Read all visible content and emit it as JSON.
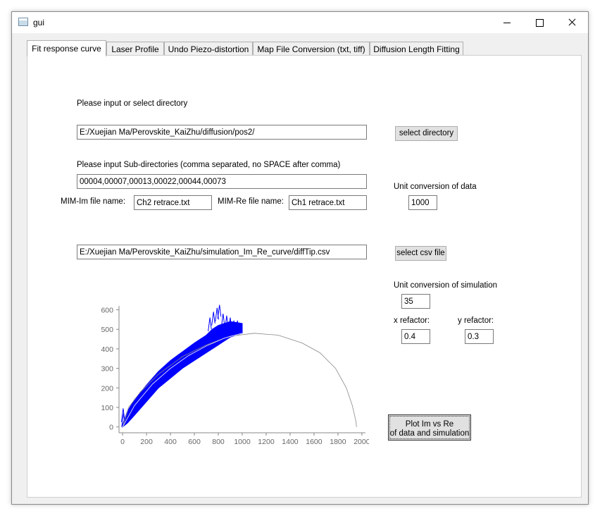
{
  "window": {
    "title": "gui",
    "icon": "window-app-icon",
    "controls": [
      "minimize-icon",
      "maximize-icon",
      "close-icon"
    ]
  },
  "tabs": [
    {
      "label": "Fit response curve",
      "active": true
    },
    {
      "label": "Laser Profile"
    },
    {
      "label": "Undo Piezo-distortion"
    },
    {
      "label": "Map File Conversion (txt, tiff)"
    },
    {
      "label": "Diffusion Length Fitting"
    }
  ],
  "form": {
    "directory_label": "Please input or select directory",
    "directory_value": "E:/Xuejian Ma/Perovskite_KaiZhu/diffusion/pos2/",
    "select_directory": "select directory",
    "subdir_label": "Please input Sub-directories (comma separated, no SPACE after comma)",
    "subdir_value": "00004,00007,00013,00022,00044,00073",
    "mim_im_label": "MIM-Im file name:",
    "mim_im_value": "Ch2 retrace.txt",
    "mim_re_label": "MIM-Re file name:",
    "mim_re_value": "Ch1 retrace.txt",
    "unit_data_label": "Unit conversion of data",
    "unit_data_value": "1000",
    "csv_value": "E:/Xuejian Ma/Perovskite_KaiZhu/simulation_Im_Re_curve/diffTip.csv",
    "select_csv": "select csv file",
    "unit_sim_label": "Unit conversion of simulation",
    "unit_sim_value": "35",
    "x_factor_label": "x refactor:",
    "x_factor_value": "0.4",
    "y_factor_label": "y refactor:",
    "y_factor_value": "0.3",
    "plot_button_line1": "Plot Im vs Re",
    "plot_button_line2": "of data and simulation"
  },
  "chart_data": {
    "type": "scatter",
    "xlim": [
      -30,
      2030
    ],
    "ylim": [
      -30,
      620
    ],
    "x_ticks": [
      0,
      200,
      400,
      600,
      800,
      1000,
      1200,
      1400,
      1600,
      1800,
      2000
    ],
    "y_ticks": [
      0,
      100,
      200,
      300,
      400,
      500,
      600
    ],
    "grid": false,
    "series": [
      {
        "kind": "data-band",
        "color": "#0000ff",
        "upper": [
          [
            0,
            10
          ],
          [
            40,
            80
          ],
          [
            100,
            140
          ],
          [
            200,
            215
          ],
          [
            300,
            285
          ],
          [
            400,
            340
          ],
          [
            500,
            385
          ],
          [
            600,
            430
          ],
          [
            700,
            470
          ],
          [
            750,
            500
          ],
          [
            800,
            520
          ],
          [
            850,
            530
          ],
          [
            900,
            540
          ],
          [
            950,
            535
          ],
          [
            1000,
            530
          ]
        ],
        "lower": [
          [
            0,
            0
          ],
          [
            40,
            20
          ],
          [
            100,
            60
          ],
          [
            200,
            130
          ],
          [
            300,
            200
          ],
          [
            400,
            250
          ],
          [
            500,
            300
          ],
          [
            600,
            340
          ],
          [
            700,
            380
          ],
          [
            750,
            400
          ],
          [
            800,
            420
          ],
          [
            850,
            440
          ],
          [
            900,
            460
          ],
          [
            950,
            470
          ],
          [
            1000,
            480
          ]
        ],
        "spikes": [
          [
            5,
            95
          ],
          [
            8,
            70
          ],
          [
            730,
            560
          ],
          [
            760,
            590
          ],
          [
            790,
            610
          ],
          [
            810,
            625
          ],
          [
            840,
            580
          ],
          [
            870,
            570
          ],
          [
            900,
            560
          ],
          [
            930,
            545
          ],
          [
            960,
            545
          ]
        ]
      },
      {
        "kind": "simulation-curve",
        "color": "#888888",
        "points": [
          [
            0,
            0
          ],
          [
            50,
            100
          ],
          [
            150,
            180
          ],
          [
            300,
            270
          ],
          [
            500,
            360
          ],
          [
            700,
            420
          ],
          [
            900,
            465
          ],
          [
            1100,
            480
          ],
          [
            1300,
            470
          ],
          [
            1500,
            430
          ],
          [
            1650,
            380
          ],
          [
            1780,
            300
          ],
          [
            1870,
            200
          ],
          [
            1920,
            110
          ],
          [
            1950,
            30
          ],
          [
            1955,
            0
          ]
        ]
      },
      {
        "kind": "fit-curve",
        "color": "#ffffff",
        "points": [
          [
            0,
            0
          ],
          [
            100,
            110
          ],
          [
            250,
            220
          ],
          [
            400,
            300
          ],
          [
            550,
            365
          ],
          [
            700,
            415
          ],
          [
            850,
            455
          ],
          [
            1000,
            480
          ]
        ]
      }
    ]
  }
}
